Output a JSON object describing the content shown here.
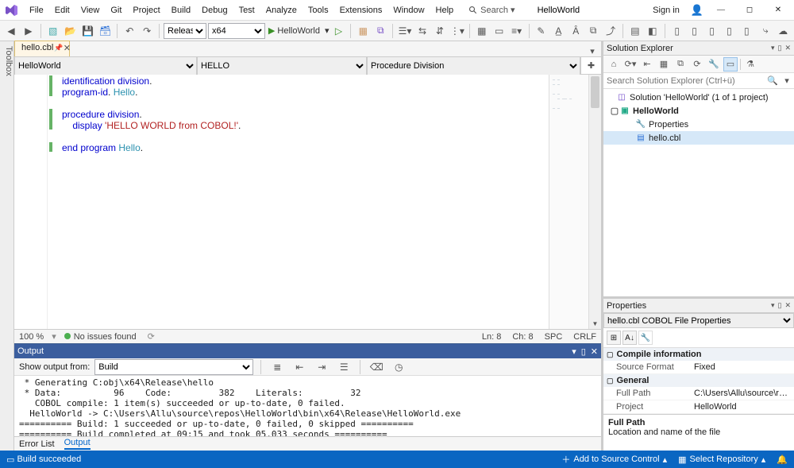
{
  "menu": [
    "File",
    "Edit",
    "View",
    "Git",
    "Project",
    "Build",
    "Debug",
    "Test",
    "Analyze",
    "Tools",
    "Extensions",
    "Window",
    "Help"
  ],
  "search_label": "Search",
  "app_title": "HelloWorld",
  "signin": "Sign in",
  "toolbar": {
    "config": "Release",
    "platform": "x64",
    "run_target": "HelloWorld"
  },
  "toolbox_label": "Toolbox",
  "document_tab": "hello.cbl",
  "nav": {
    "project": "HelloWorld",
    "scope": "HELLO",
    "member": "Procedure Division"
  },
  "code": {
    "l1a": "identification division",
    "l1b": ".",
    "l2a": "program-id",
    "l2b": ". ",
    "l2c": "Hello",
    "l2d": ".",
    "l4a": "procedure division",
    "l4b": ".",
    "l5a": "    ",
    "l5b": "display",
    "l5c": " ",
    "l5d": "'HELLO WORLD from COBOL!'",
    "l5e": ".",
    "l7a": "end program",
    "l7b": " ",
    "l7c": "Hello",
    "l7d": "."
  },
  "minimap": "— —\n— —\n\n— —\n  — —— —\n\n— —",
  "editor_status": {
    "zoom": "100 %",
    "issues": "No issues found",
    "ln": "Ln: 8",
    "ch": "Ch: 8",
    "spc": "SPC",
    "eol": "CRLF"
  },
  "output": {
    "title": "Output",
    "from_label": "Show output from:",
    "from_value": "Build",
    "text": " * Generating C:obj\\x64\\Release\\hello\n * Data:          96    Code:         382    Literals:         32\n   COBOL compile: 1 item(s) succeeded or up-to-date, 0 failed.\n  HelloWorld -> C:\\Users\\Allu\\source\\repos\\HelloWorld\\bin\\x64\\Release\\HelloWorld.exe\n========== Build: 1 succeeded or up-to-date, 0 failed, 0 skipped ==========\n========== Build completed at 09:15 and took 05,033 seconds =========="
  },
  "bottom_tabs": {
    "error": "Error List",
    "output": "Output"
  },
  "solution_explorer": {
    "title": "Solution Explorer",
    "search_placeholder": "Search Solution Explorer (Ctrl+ü)",
    "root": "Solution 'HelloWorld' (1 of 1 project)",
    "project": "HelloWorld",
    "properties": "Properties",
    "file": "hello.cbl"
  },
  "properties": {
    "title": "Properties",
    "subject": "hello.cbl COBOL File Properties",
    "cat_compile": "Compile information",
    "k_fmt": "Source Format",
    "v_fmt": "Fixed",
    "cat_general": "General",
    "k_path": "Full Path",
    "v_path": "C:\\Users\\Allu\\source\\repos\\HelloWorld\\hello.cbl",
    "k_proj": "Project",
    "v_proj": "HelloWorld",
    "desc_title": "Full Path",
    "desc_text": "Location and name of the file"
  },
  "statusbar": {
    "build": "Build succeeded",
    "add_source": "Add to Source Control",
    "select_repo": "Select Repository"
  }
}
